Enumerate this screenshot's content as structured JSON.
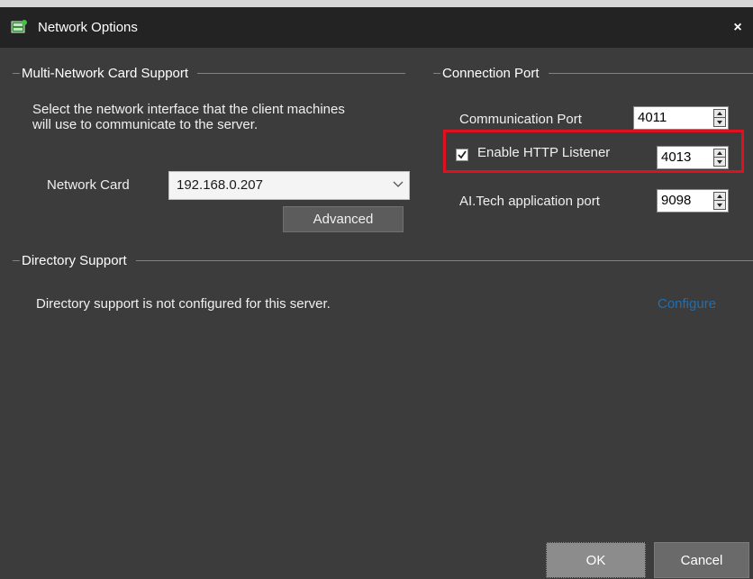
{
  "window": {
    "title": "Network Options",
    "close_glyph": "×",
    "icon": "network-options-icon"
  },
  "multi_network": {
    "header": "Multi-Network Card Support",
    "description": "Select the network interface that the client machines will use to communicate to the server.",
    "network_card_label": "Network Card",
    "network_card_value": "192.168.0.207",
    "advanced_label": "Advanced"
  },
  "connection_port": {
    "header": "Connection Port",
    "communication_port_label": "Communication Port",
    "communication_port_value": "4011",
    "http_listener_label": "Enable HTTP Listener",
    "http_listener_checked": true,
    "http_listener_value": "4013",
    "aitech_label": "AI.Tech application port",
    "aitech_value": "9098"
  },
  "directory": {
    "header": "Directory Support",
    "message": "Directory support is not configured for this server.",
    "configure_label": "Configure"
  },
  "footer": {
    "ok_label": "OK",
    "cancel_label": "Cancel"
  },
  "colors": {
    "background": "#3c3c3c",
    "titlebar": "#232323",
    "accent_line": "#c87028",
    "highlight": "#e0101e",
    "link": "#1f6fb2"
  }
}
